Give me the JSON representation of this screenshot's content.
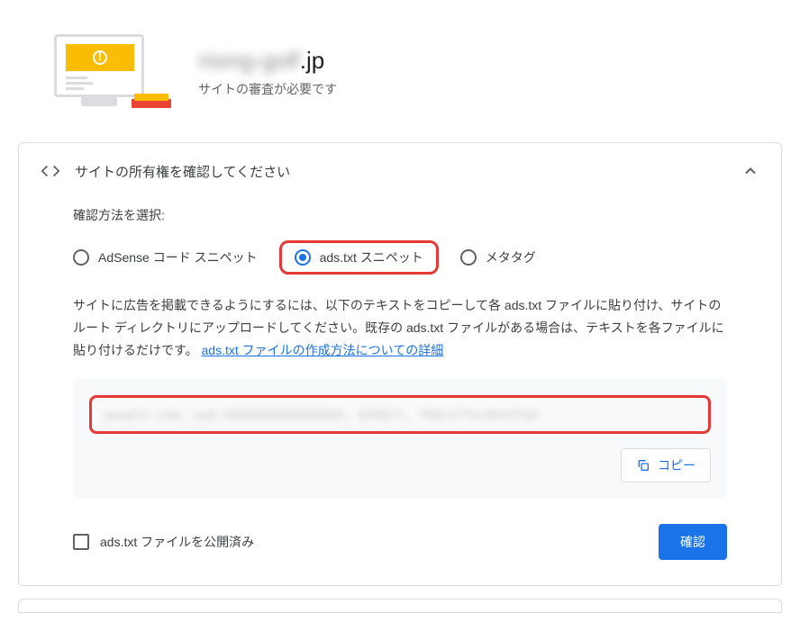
{
  "header": {
    "site_prefix": "rising-golf",
    "site_suffix": ".jp",
    "subtitle": "サイトの審査が必要です"
  },
  "accordion": {
    "title": "サイトの所有権を確認してください"
  },
  "method": {
    "label": "確認方法を選択:",
    "options": {
      "adsense": "AdSense コード スニペット",
      "adstxt": "ads.txt スニペット",
      "metatag": "メタタグ"
    }
  },
  "description": {
    "text": "サイトに広告を掲載できるようにするには、以下のテキストをコピーして各 ads.txt ファイルに貼り付け、サイトのルート ディレクトリにアップロードしてください。既存の ads.txt ファイルがある場合は、テキストを各ファイルに貼り付けるだけです。 ",
    "link": "ads.txt ファイルの作成方法についての詳細"
  },
  "snippet": {
    "content": "google.com, pub-0000000000000000, DIRECT, f08c47fec0942fa0"
  },
  "copy_label": "コピー",
  "checkbox_label": "ads.txt ファイルを公開済み",
  "confirm_label": "確認"
}
